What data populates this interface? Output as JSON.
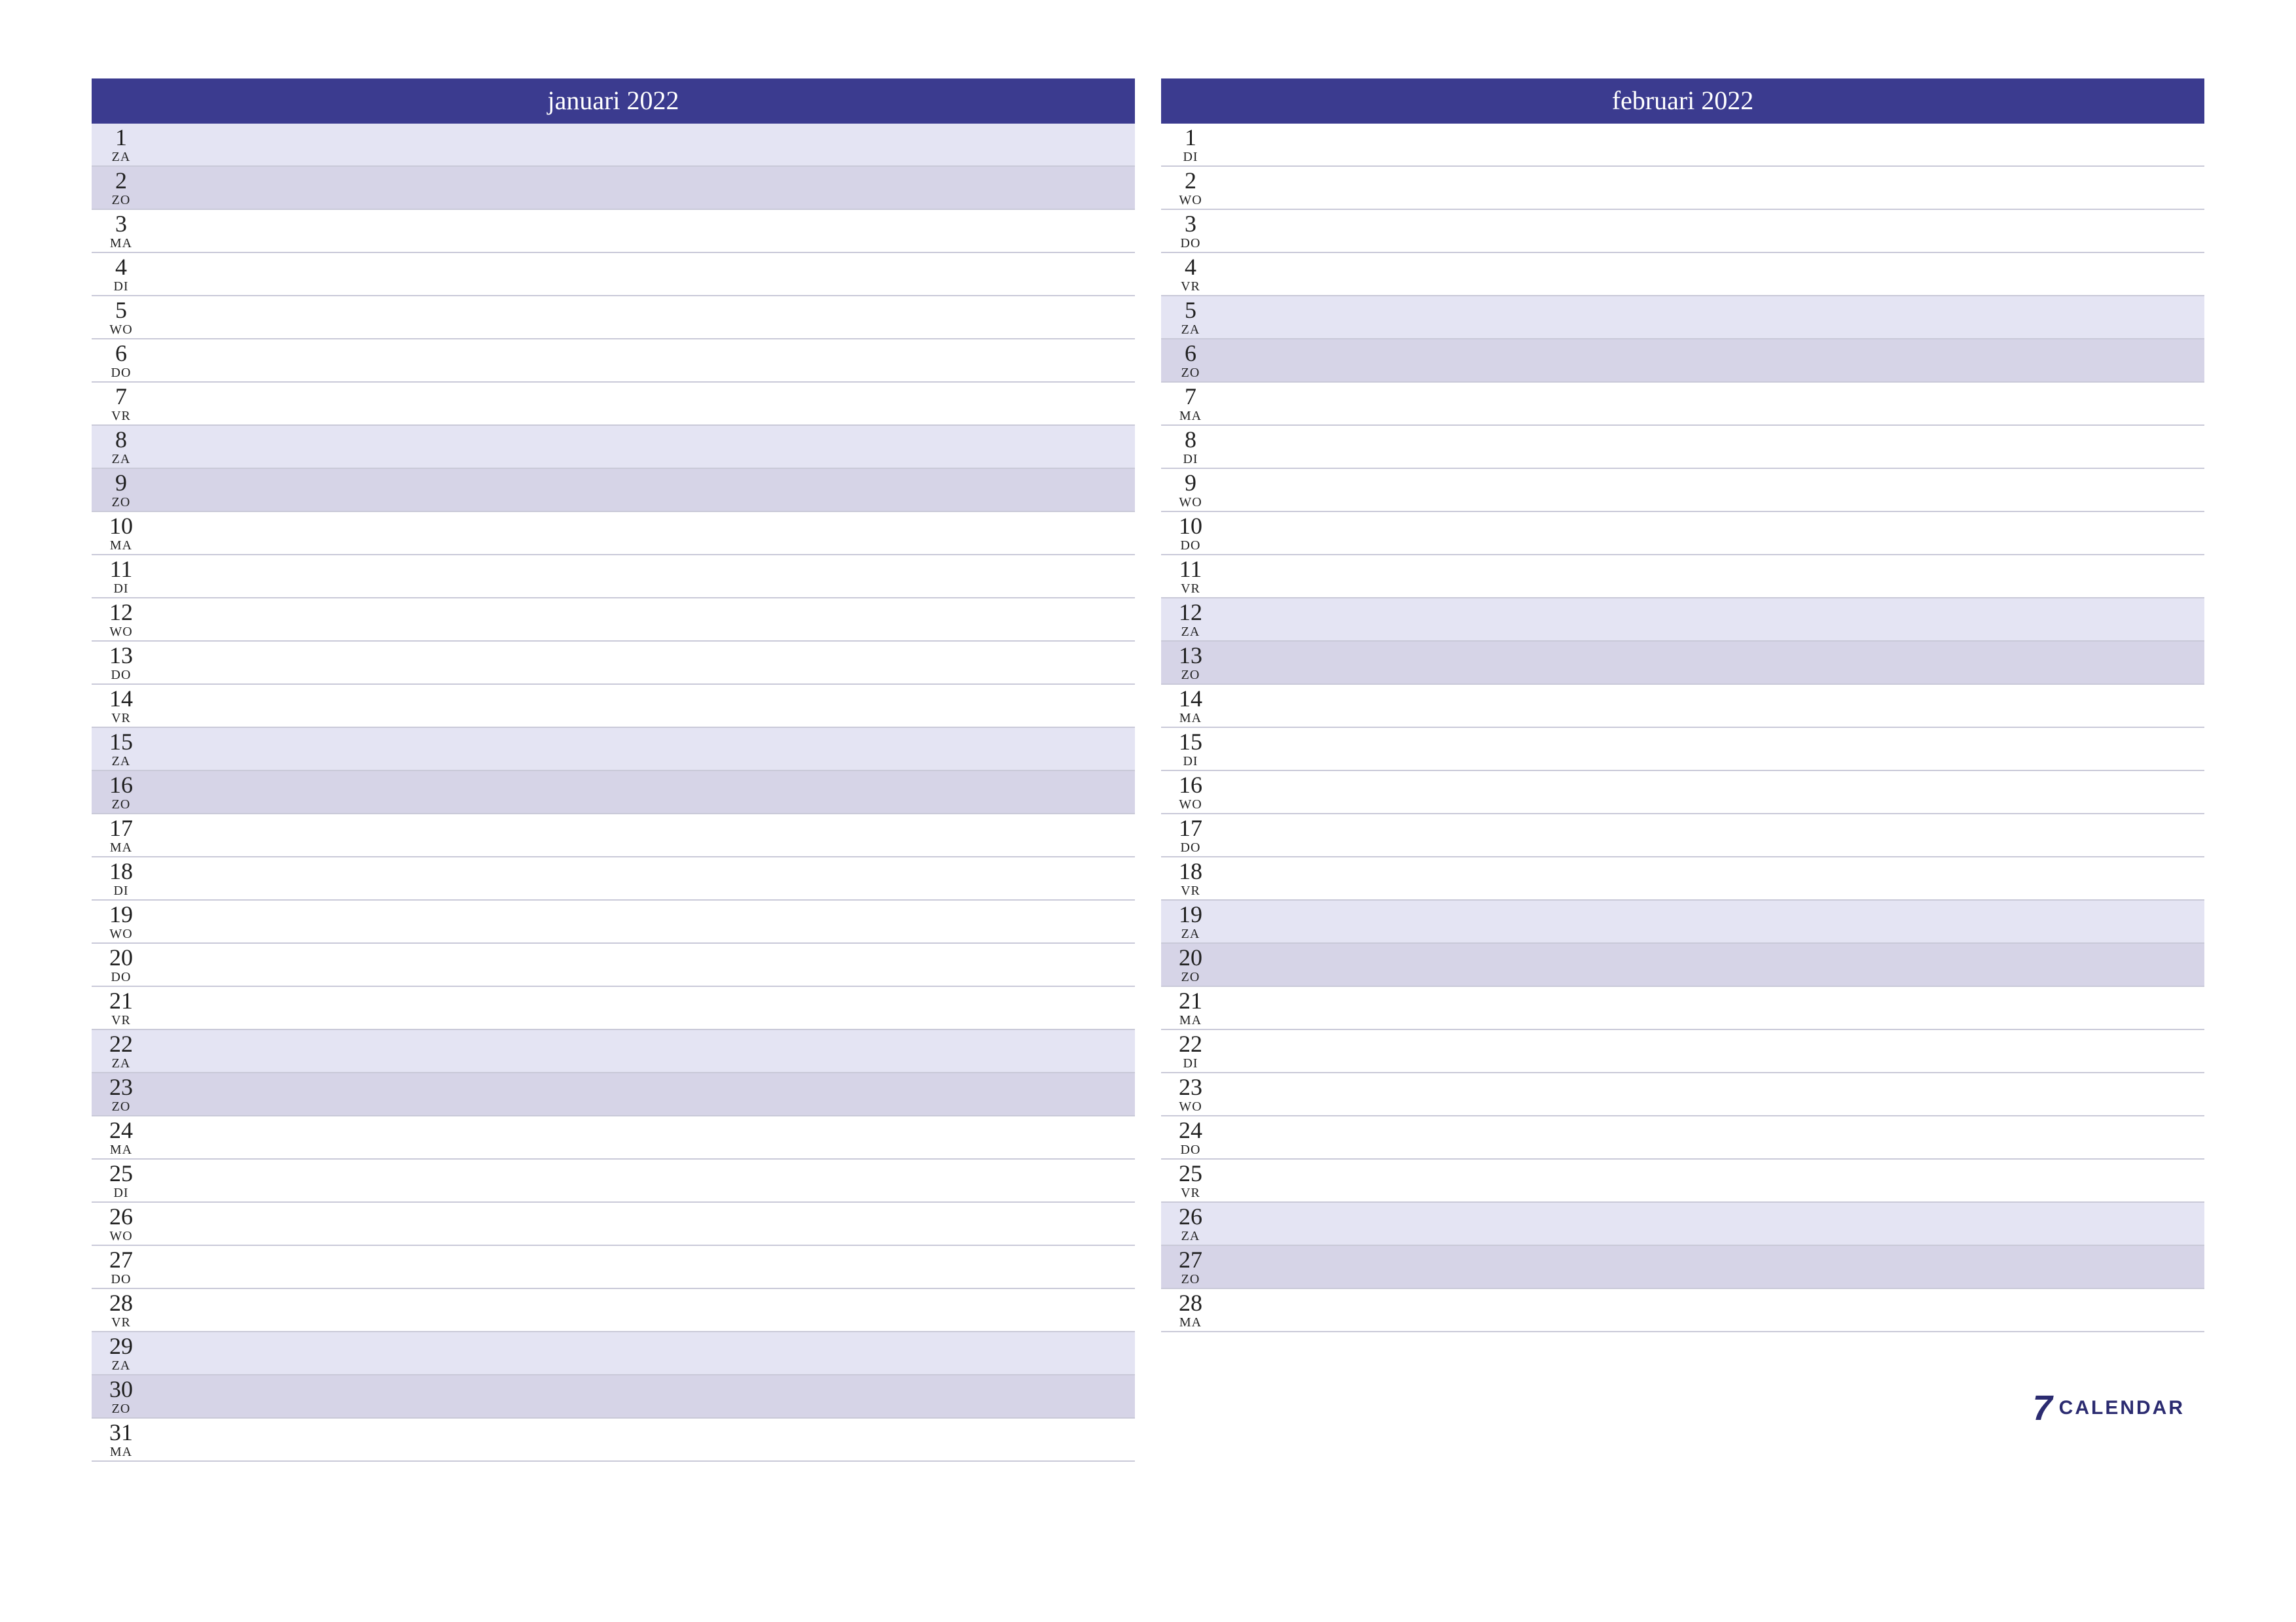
{
  "logo": {
    "seven": "7",
    "text": "CALENDAR"
  },
  "colors": {
    "header_bg": "#3b3b8f",
    "saturday_bg": "#e4e4f3",
    "sunday_bg": "#d6d4e7"
  },
  "months": [
    {
      "title": "januari 2022",
      "days": [
        {
          "num": "1",
          "dow": "ZA",
          "type": "sat"
        },
        {
          "num": "2",
          "dow": "ZO",
          "type": "sun"
        },
        {
          "num": "3",
          "dow": "MA",
          "type": "plain"
        },
        {
          "num": "4",
          "dow": "DI",
          "type": "plain"
        },
        {
          "num": "5",
          "dow": "WO",
          "type": "plain"
        },
        {
          "num": "6",
          "dow": "DO",
          "type": "plain"
        },
        {
          "num": "7",
          "dow": "VR",
          "type": "plain"
        },
        {
          "num": "8",
          "dow": "ZA",
          "type": "sat"
        },
        {
          "num": "9",
          "dow": "ZO",
          "type": "sun"
        },
        {
          "num": "10",
          "dow": "MA",
          "type": "plain"
        },
        {
          "num": "11",
          "dow": "DI",
          "type": "plain"
        },
        {
          "num": "12",
          "dow": "WO",
          "type": "plain"
        },
        {
          "num": "13",
          "dow": "DO",
          "type": "plain"
        },
        {
          "num": "14",
          "dow": "VR",
          "type": "plain"
        },
        {
          "num": "15",
          "dow": "ZA",
          "type": "sat"
        },
        {
          "num": "16",
          "dow": "ZO",
          "type": "sun"
        },
        {
          "num": "17",
          "dow": "MA",
          "type": "plain"
        },
        {
          "num": "18",
          "dow": "DI",
          "type": "plain"
        },
        {
          "num": "19",
          "dow": "WO",
          "type": "plain"
        },
        {
          "num": "20",
          "dow": "DO",
          "type": "plain"
        },
        {
          "num": "21",
          "dow": "VR",
          "type": "plain"
        },
        {
          "num": "22",
          "dow": "ZA",
          "type": "sat"
        },
        {
          "num": "23",
          "dow": "ZO",
          "type": "sun"
        },
        {
          "num": "24",
          "dow": "MA",
          "type": "plain"
        },
        {
          "num": "25",
          "dow": "DI",
          "type": "plain"
        },
        {
          "num": "26",
          "dow": "WO",
          "type": "plain"
        },
        {
          "num": "27",
          "dow": "DO",
          "type": "plain"
        },
        {
          "num": "28",
          "dow": "VR",
          "type": "plain"
        },
        {
          "num": "29",
          "dow": "ZA",
          "type": "sat"
        },
        {
          "num": "30",
          "dow": "ZO",
          "type": "sun"
        },
        {
          "num": "31",
          "dow": "MA",
          "type": "plain"
        }
      ]
    },
    {
      "title": "februari 2022",
      "days": [
        {
          "num": "1",
          "dow": "DI",
          "type": "plain"
        },
        {
          "num": "2",
          "dow": "WO",
          "type": "plain"
        },
        {
          "num": "3",
          "dow": "DO",
          "type": "plain"
        },
        {
          "num": "4",
          "dow": "VR",
          "type": "plain"
        },
        {
          "num": "5",
          "dow": "ZA",
          "type": "sat"
        },
        {
          "num": "6",
          "dow": "ZO",
          "type": "sun"
        },
        {
          "num": "7",
          "dow": "MA",
          "type": "plain"
        },
        {
          "num": "8",
          "dow": "DI",
          "type": "plain"
        },
        {
          "num": "9",
          "dow": "WO",
          "type": "plain"
        },
        {
          "num": "10",
          "dow": "DO",
          "type": "plain"
        },
        {
          "num": "11",
          "dow": "VR",
          "type": "plain"
        },
        {
          "num": "12",
          "dow": "ZA",
          "type": "sat"
        },
        {
          "num": "13",
          "dow": "ZO",
          "type": "sun"
        },
        {
          "num": "14",
          "dow": "MA",
          "type": "plain"
        },
        {
          "num": "15",
          "dow": "DI",
          "type": "plain"
        },
        {
          "num": "16",
          "dow": "WO",
          "type": "plain"
        },
        {
          "num": "17",
          "dow": "DO",
          "type": "plain"
        },
        {
          "num": "18",
          "dow": "VR",
          "type": "plain"
        },
        {
          "num": "19",
          "dow": "ZA",
          "type": "sat"
        },
        {
          "num": "20",
          "dow": "ZO",
          "type": "sun"
        },
        {
          "num": "21",
          "dow": "MA",
          "type": "plain"
        },
        {
          "num": "22",
          "dow": "DI",
          "type": "plain"
        },
        {
          "num": "23",
          "dow": "WO",
          "type": "plain"
        },
        {
          "num": "24",
          "dow": "DO",
          "type": "plain"
        },
        {
          "num": "25",
          "dow": "VR",
          "type": "plain"
        },
        {
          "num": "26",
          "dow": "ZA",
          "type": "sat"
        },
        {
          "num": "27",
          "dow": "ZO",
          "type": "sun"
        },
        {
          "num": "28",
          "dow": "MA",
          "type": "plain"
        }
      ]
    }
  ]
}
